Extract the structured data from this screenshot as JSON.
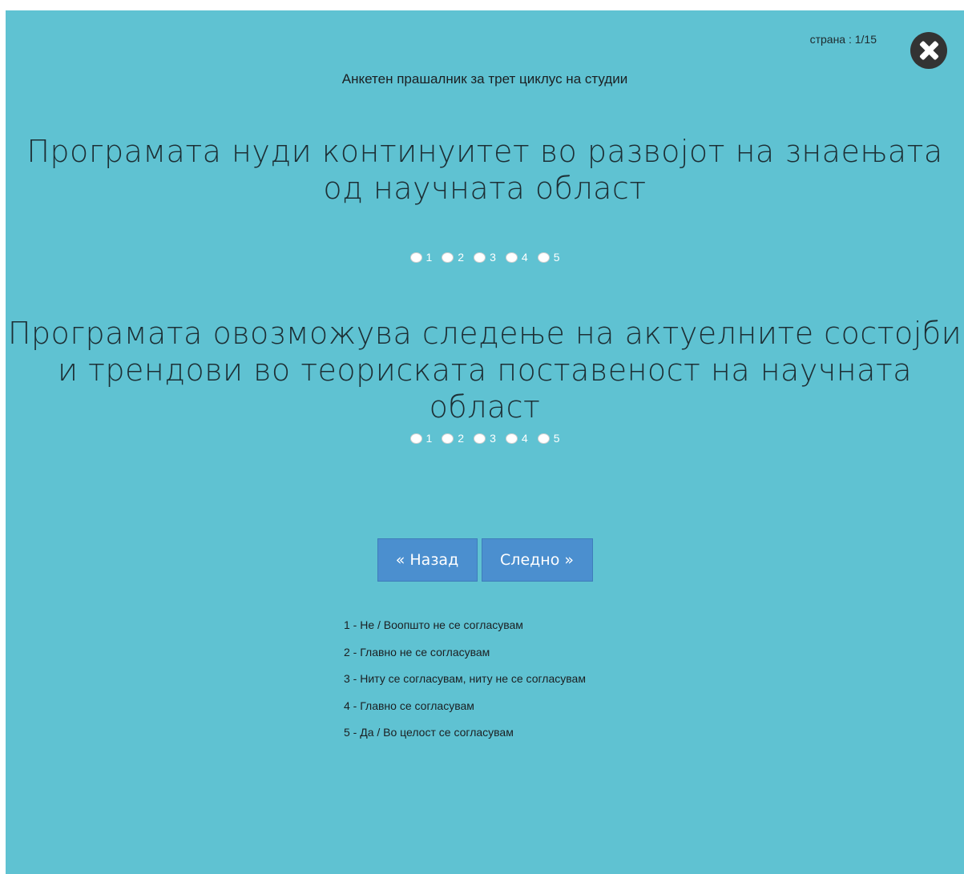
{
  "header": {
    "page_indicator": "страна : 1/15",
    "close_icon": "close-circle-icon",
    "survey_title": "Анкетен прашалник за трет циклус на студии"
  },
  "questions": [
    {
      "text": "Програмата нуди континуитет во развојот на знаењата од научната област",
      "options": [
        "1",
        "2",
        "3",
        "4",
        "5"
      ]
    },
    {
      "text": "Програмата овозможува следење на актуелните состојби и трендови во теориската поставеност на научната област",
      "options": [
        "1",
        "2",
        "3",
        "4",
        "5"
      ]
    }
  ],
  "navigation": {
    "back_icon": "«",
    "back_label": "Назад",
    "next_label": "Следно",
    "next_icon": "»"
  },
  "legend": [
    "1 - Не / Воопшто не се согласувам",
    "2 - Главно не се согласувам",
    "3 - Ниту се согласувам, ниту не се согласувам",
    "4 - Главно се согласувам",
    "5 - Да / Во целост се согласувам"
  ],
  "colors": {
    "background": "#5fc2d2",
    "button": "#4b8fcf",
    "close_button": "#333333"
  }
}
